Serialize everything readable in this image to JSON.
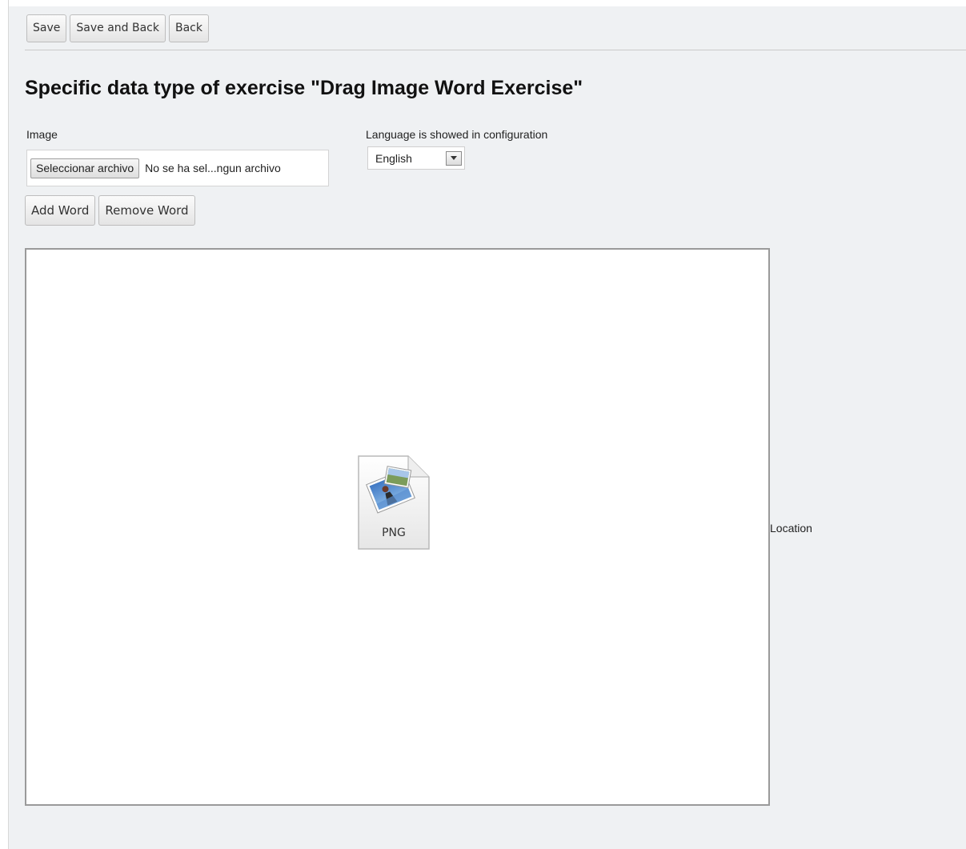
{
  "toolbar": {
    "save_label": "Save",
    "save_and_back_label": "Save and Back",
    "back_label": "Back"
  },
  "page_title": "Specific data type of exercise \"Drag Image Word Exercise\"",
  "image_field": {
    "label": "Image",
    "choose_file_label": "Seleccionar archivo",
    "file_status": "No se ha sel...ngun archivo"
  },
  "language": {
    "label": "Language is showed in configuration",
    "selected": "English"
  },
  "word_actions": {
    "add_label": "Add Word",
    "remove_label": "Remove Word"
  },
  "canvas": {
    "file_type_label": "PNG",
    "icon": "png-file-icon"
  },
  "location_label": "Location"
}
